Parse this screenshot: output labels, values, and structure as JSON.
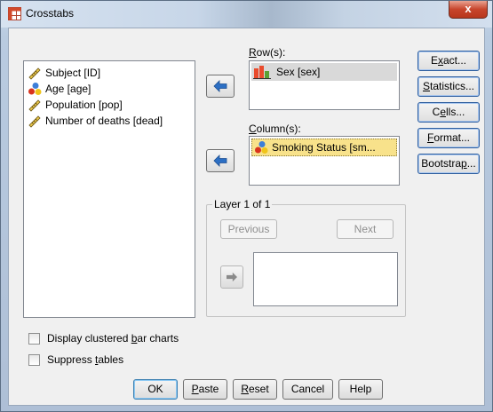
{
  "window": {
    "title": "Crosstabs",
    "close_glyph": "x"
  },
  "variables": [
    {
      "label": "Subject [ID]",
      "icon": "ruler-icon"
    },
    {
      "label": "Age [age]",
      "icon": "nominal-icon"
    },
    {
      "label": "Population [pop]",
      "icon": "ruler-icon"
    },
    {
      "label": "Number of deaths [dead]",
      "icon": "ruler-icon"
    }
  ],
  "rows": {
    "label_prefix": "R",
    "label_rest": "ow(s):",
    "item": "Sex [sex]"
  },
  "columns": {
    "label_prefix": "C",
    "label_rest": "olumn(s):",
    "item": "Smoking Status [sm..."
  },
  "layer": {
    "title": "Layer 1 of 1",
    "previous": "Previous",
    "next": "Next"
  },
  "side_buttons": [
    {
      "pre": "E",
      "u": "x",
      "post": "act..."
    },
    {
      "pre": "",
      "u": "S",
      "post": "tatistics..."
    },
    {
      "pre": "C",
      "u": "e",
      "post": "lls..."
    },
    {
      "pre": "",
      "u": "F",
      "post": "ormat..."
    },
    {
      "pre": "Bootstra",
      "u": "p",
      "post": "..."
    }
  ],
  "options": {
    "clustered": {
      "pre": "Display clustered ",
      "u": "b",
      "post": "ar charts"
    },
    "suppress": {
      "pre": "Suppress ",
      "u": "t",
      "post": "ables"
    }
  },
  "bottom_buttons": {
    "ok": "OK",
    "paste": {
      "u": "P",
      "post": "aste"
    },
    "reset": {
      "u": "R",
      "post": "eset"
    },
    "cancel": "Cancel",
    "help": "Help"
  },
  "colors": {
    "selection_fill": "#d9d9d9",
    "column_selection_fill": "#f8e28b",
    "arrow_blue": "#2c6fc4"
  }
}
